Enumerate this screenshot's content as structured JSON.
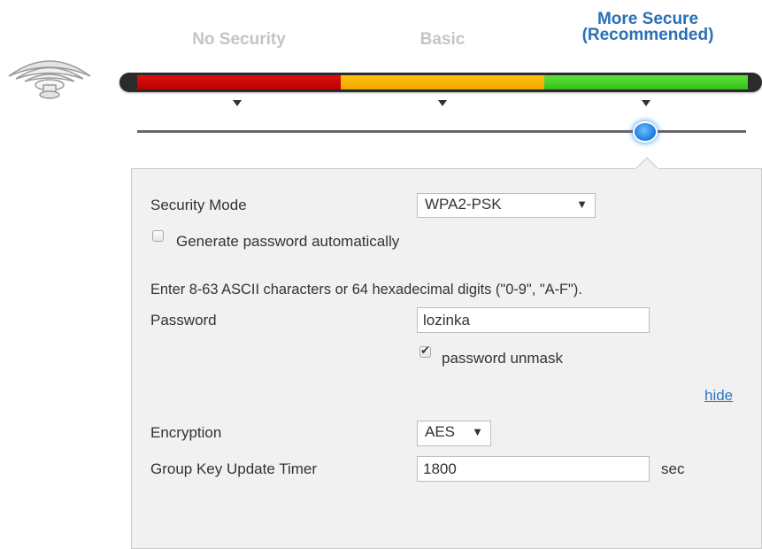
{
  "levels": [
    {
      "label": "No Security",
      "state": "inactive"
    },
    {
      "label": "Basic",
      "state": "inactive"
    },
    {
      "label": "More Secure\n(Recommended)",
      "state": "selected"
    }
  ],
  "slider": {
    "selected_index": 2,
    "level_colors": [
      "#cc0000",
      "#fdb813",
      "#3fce25"
    ]
  },
  "form": {
    "security_mode_label": "Security Mode",
    "security_mode_value": "WPA2-PSK",
    "generate_label": "Generate password automatically",
    "generate_checked": false,
    "hint": "Enter 8-63 ASCII characters or 64 hexadecimal digits (\"0-9\", \"A-F\").",
    "password_label": "Password",
    "password_value": "lozinka",
    "unmask_label": "password unmask",
    "unmask_checked": true,
    "hide_link": "hide",
    "encryption_label": "Encryption",
    "encryption_value": "AES",
    "timer_label": "Group Key Update Timer",
    "timer_value": "1800",
    "timer_unit": "sec"
  },
  "icons": {
    "wifi": "wifi-router-icon",
    "dropdown": "chevron-down-icon"
  }
}
